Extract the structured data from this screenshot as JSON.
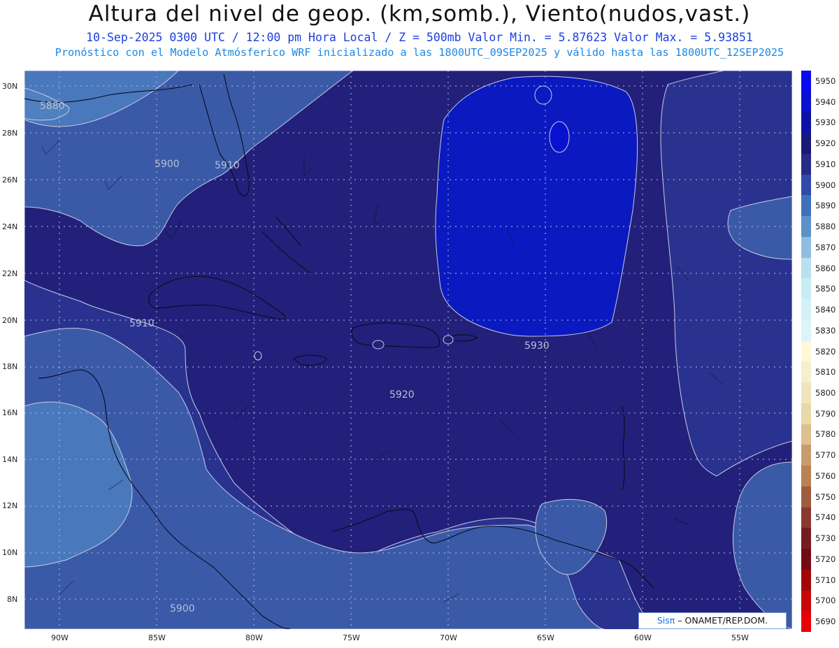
{
  "header": {
    "title": "Altura del nivel de geop. (km,somb.), Viento(nudos,vast.)",
    "subtitle": "10-Sep-2025  0300 UTC / 12:00 pm Hora Local / Z = 500mb    Valor Min. = 5.87623  Valor Max. = 5.93851",
    "forecast_note": "Pronóstico con el Modelo Atmósferico WRF inicializado a las 1800UTC_09SEP2025 y válido hasta las  1800UTC_12SEP2025"
  },
  "map": {
    "lat_labels": [
      "30N",
      "28N",
      "26N",
      "24N",
      "22N",
      "20N",
      "18N",
      "16N",
      "14N",
      "12N",
      "10N",
      "8N"
    ],
    "lon_labels": [
      "90W",
      "85W",
      "80W",
      "75W",
      "70W",
      "65W",
      "60W",
      "55W"
    ],
    "contour_labels": [
      "5880",
      "5900",
      "5910",
      "5910",
      "5920",
      "5930",
      "5900"
    ],
    "colors": {
      "h5880": "#4f80bf",
      "h5890": "#4a78bc",
      "h5900": "#3a5aa8",
      "h5910": "#2a3290",
      "h5920": "#22207a",
      "h5930": "#0a1ac0",
      "contour": "#c7cbe0"
    }
  },
  "colorbar": {
    "levels": [
      "5950",
      "5940",
      "5930",
      "5920",
      "5910",
      "5900",
      "5890",
      "5880",
      "5870",
      "5860",
      "5850",
      "5840",
      "5830",
      "5820",
      "5810",
      "5800",
      "5790",
      "5780",
      "5770",
      "5760",
      "5750",
      "5740",
      "5730",
      "5720",
      "5710",
      "5700",
      "5690"
    ],
    "colors": [
      "#0a0af0",
      "#0a10d0",
      "#0c12a8",
      "#1a1878",
      "#262b88",
      "#2f4aa8",
      "#3f70b8",
      "#5a92c8",
      "#8fbee0",
      "#b9e0ee",
      "#c8ecf4",
      "#d4f1f7",
      "#dcf4f8",
      "#fff8d8",
      "#f6efcf",
      "#f0e4bc",
      "#e8d8aa",
      "#dcc090",
      "#c89c6a",
      "#b88252",
      "#a05c3e",
      "#8a3830",
      "#741c22",
      "#740a14",
      "#a00808",
      "#c80606",
      "#e80202"
    ]
  },
  "credit": {
    "brand": "Sisπ",
    "text": "– ONAMET/REP.DOM."
  }
}
